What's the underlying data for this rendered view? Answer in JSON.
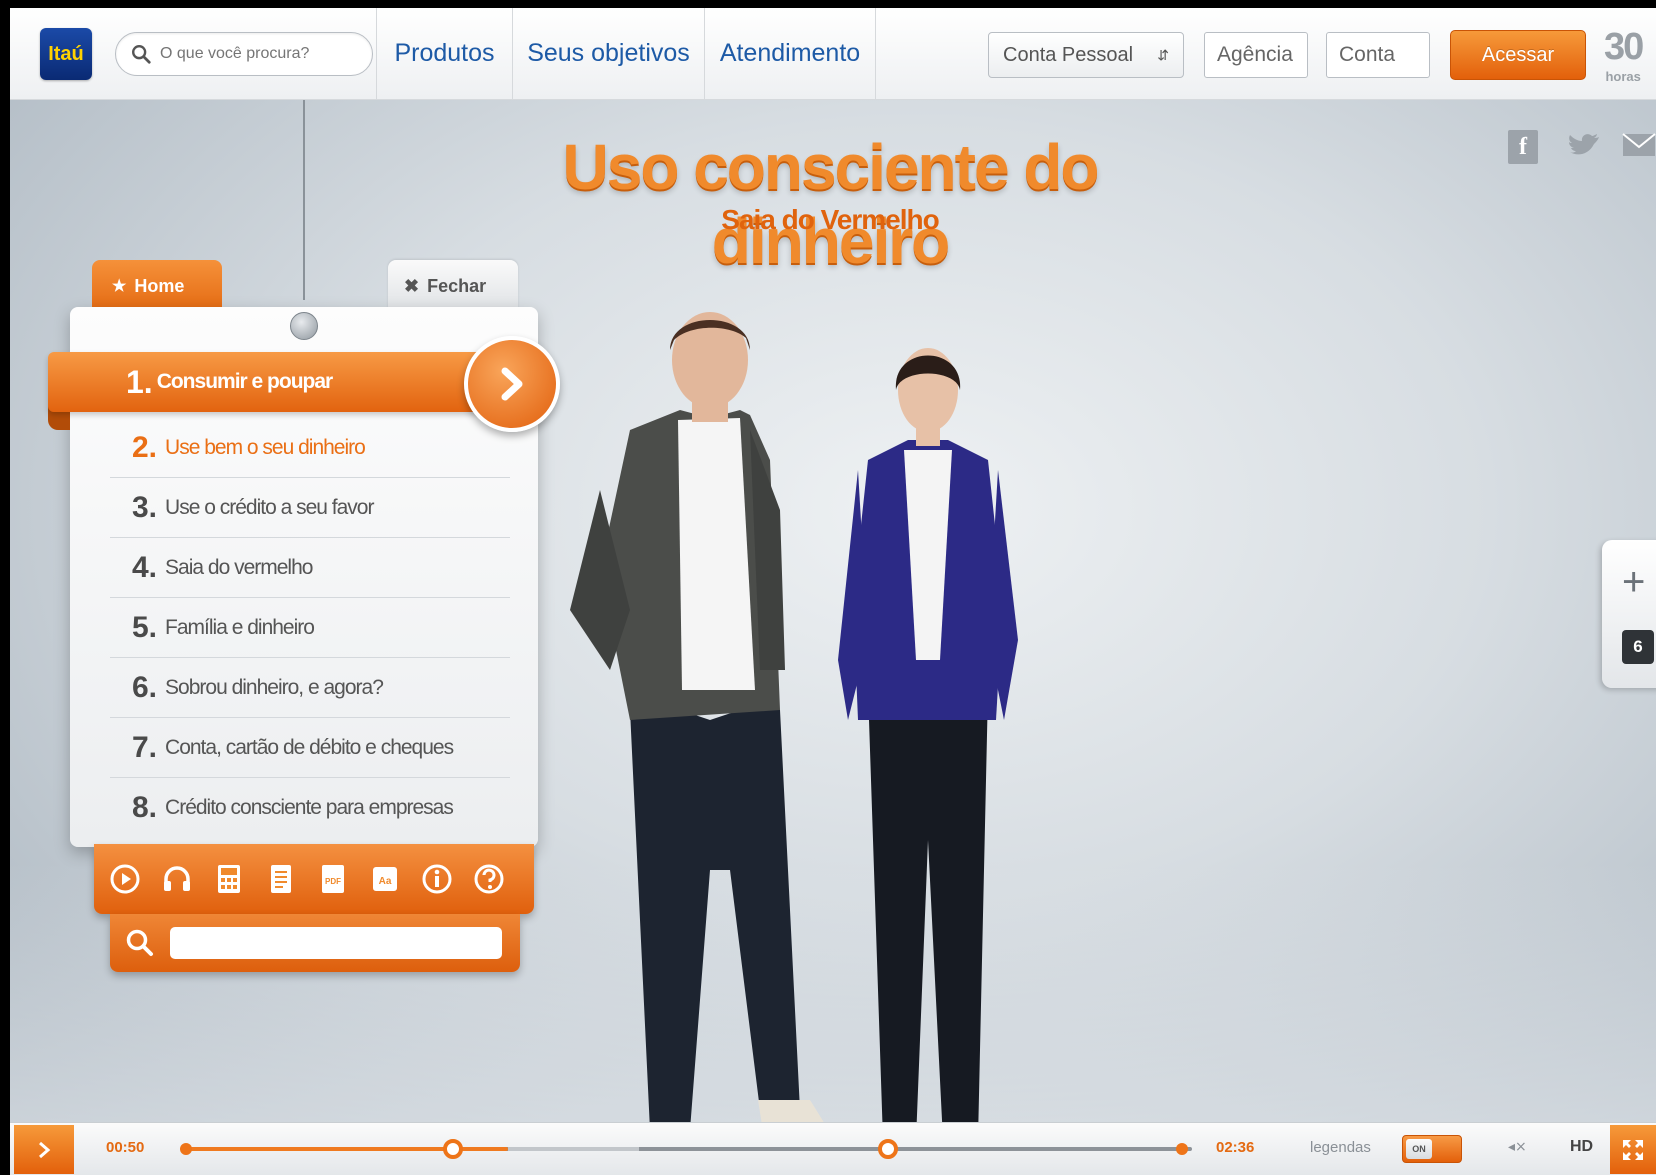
{
  "header": {
    "logo_text": "Itaú",
    "search_placeholder": "O que você procura?",
    "nav": [
      "Produtos",
      "Seus objetivos",
      "Atendimento"
    ],
    "account_type": "Conta Pessoal",
    "agency_placeholder": "Agência",
    "account_placeholder": "Conta",
    "login_button": "Acessar",
    "badge_number": "30",
    "badge_text": "horas"
  },
  "hero": {
    "title": "Uso consciente do dinheiro",
    "subtitle": "Saia do Vermelho"
  },
  "social": {
    "facebook": "f",
    "icons": [
      "facebook-icon",
      "twitter-icon",
      "mail-icon"
    ]
  },
  "menu": {
    "home_tab": "Home",
    "close_tab": "Fechar",
    "active": {
      "num": "1.",
      "label": "Consumir e poupar"
    },
    "items": [
      {
        "num": "2.",
        "label": "Use bem o seu dinheiro"
      },
      {
        "num": "3.",
        "label": "Use o crédito a seu favor"
      },
      {
        "num": "4.",
        "label": "Saia do vermelho"
      },
      {
        "num": "5.",
        "label": "Família e dinheiro"
      },
      {
        "num": "6.",
        "label": "Sobrou dinheiro, e agora?"
      },
      {
        "num": "7.",
        "label": "Conta, cartão de débito e cheques"
      },
      {
        "num": "8.",
        "label": "Crédito consciente para empresas"
      }
    ],
    "tools": [
      "play-icon",
      "headphones-icon",
      "calculator-icon",
      "document-icon",
      "pdf-icon",
      "font-size-icon",
      "info-icon",
      "help-icon"
    ],
    "tool_pdf": "PDF",
    "tool_font": "Aa"
  },
  "side_widget": {
    "plus": "+",
    "count": "6"
  },
  "player": {
    "current_time": "00:50",
    "total_time": "02:36",
    "progress": 0.32,
    "buffered": 0.45,
    "captions_label": "legendas",
    "captions_state": "ON",
    "mute": "◂×",
    "quality": "HD"
  },
  "colors": {
    "accent": "#e8690f",
    "nav_blue": "#1d5aa6"
  }
}
